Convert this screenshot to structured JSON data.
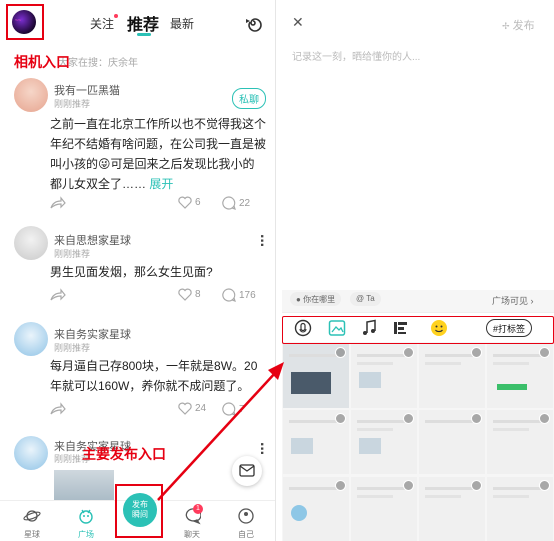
{
  "left": {
    "tabs": {
      "follow": "关注",
      "recommend": "推荐",
      "latest": "最新"
    },
    "search_hint": "大家在搜：庆余年",
    "camera_annotation": "相机入口",
    "publish_annotation": "主要发布入口",
    "posts": [
      {
        "username": "我有一匹黑猫",
        "time": "刚刚推荐",
        "chat_button": "私聊",
        "content": "之前一直在北京工作所以也不觉得我这个年纪不结婚有啥问题，在公司我一直是被叫小孩的😜可是回来之后发现比我小的都儿女双全了……",
        "expand": "展开",
        "likes": "6",
        "comments": "22"
      },
      {
        "username": "来自思想家星球",
        "time": "刚刚推荐",
        "content": "男生见面发烟，那么女生见面?",
        "likes": "8",
        "comments": "176"
      },
      {
        "username": "来自务实家星球",
        "time": "刚刚推荐",
        "content": "每月逼自己存800块，一年就是8W。20年就可以160W，养你就不成问题了。",
        "likes": "24",
        "comments": "7"
      },
      {
        "username": "来自务实家星球",
        "time": "刚刚推荐"
      }
    ],
    "nav": {
      "planet": "星球",
      "square": "广场",
      "publish": "发布瞬间",
      "publish_line1": "发布",
      "publish_line2": "瞬间",
      "moments": "聊天",
      "me": "自己",
      "moments_badge": "1"
    }
  },
  "right": {
    "publish": "发布",
    "placeholder": "记录这一刻，晒给懂你的人...",
    "location": "你在哪里",
    "at": "Ta",
    "visibility": "广场可见 ›",
    "tag_button": "#打标签"
  },
  "colors": {
    "accent": "#2bc1b6",
    "annotation": "#e60012"
  }
}
